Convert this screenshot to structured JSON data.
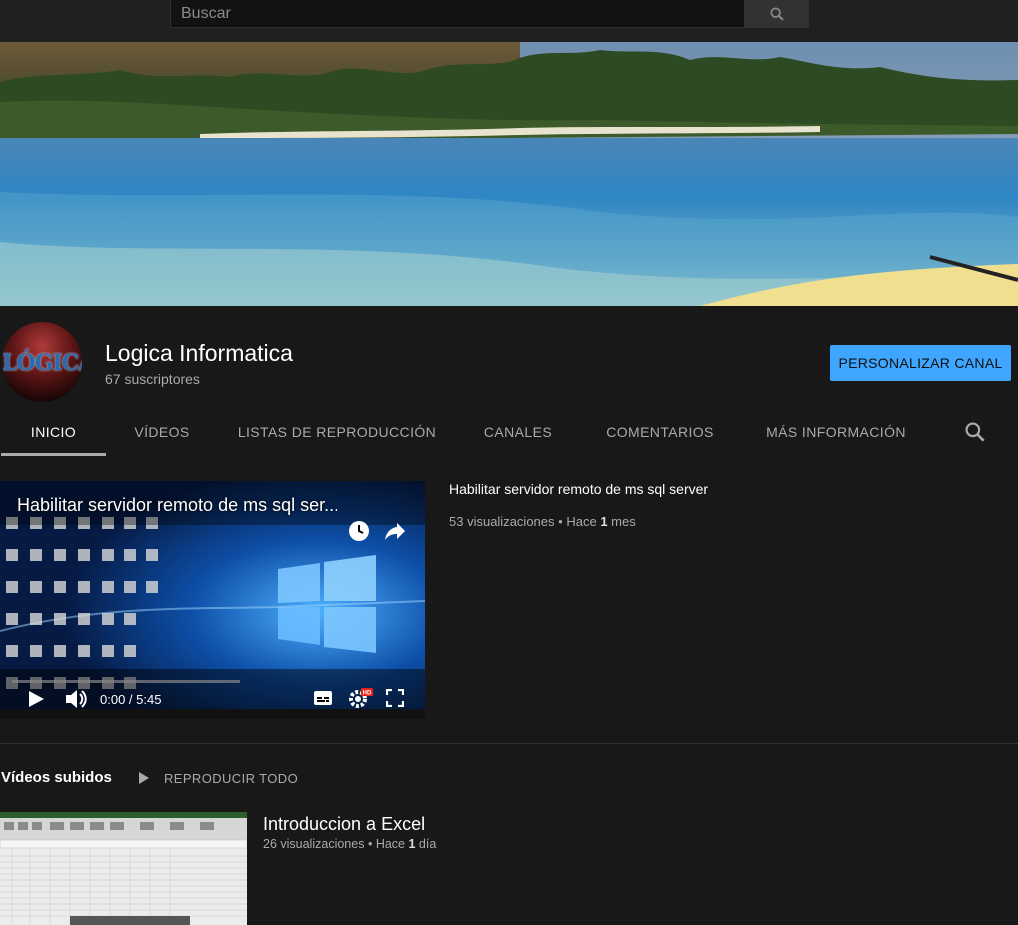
{
  "search": {
    "placeholder": "Buscar"
  },
  "channel": {
    "avatar_text": "LÓGICA",
    "name": "Logica Informatica",
    "subscribers": "67 suscriptores",
    "customize_label": "PERSONALIZAR CANAL"
  },
  "tabs": [
    {
      "label": "INICIO",
      "active": true
    },
    {
      "label": "VÍDEOS",
      "active": false
    },
    {
      "label": "LISTAS DE REPRODUCCIÓN",
      "active": false
    },
    {
      "label": "CANALES",
      "active": false
    },
    {
      "label": "COMENTARIOS",
      "active": false
    },
    {
      "label": "MÁS INFORMACIÓN",
      "active": false
    }
  ],
  "featured": {
    "player_title": "Habilitar servidor remoto de ms sql ser...",
    "player_time": "0:00 / 5:45",
    "title": "Habilitar servidor remoto de ms sql server",
    "views": "53 visualizaciones",
    "separator": "•",
    "age_prefix": "Hace",
    "age_number": "1",
    "age_unit": "mes"
  },
  "uploads": {
    "section_title": "Vídeos subidos",
    "play_all_label": "REPRODUCIR TODO",
    "videos": [
      {
        "title": "Introduccion a Excel",
        "views": "26 visualizaciones",
        "separator": "•",
        "age_prefix": "Hace",
        "age_number": "1",
        "age_unit": "día"
      }
    ]
  },
  "colors": {
    "accent": "#3ea6ff",
    "background": "#181818",
    "topbar": "#202020"
  }
}
